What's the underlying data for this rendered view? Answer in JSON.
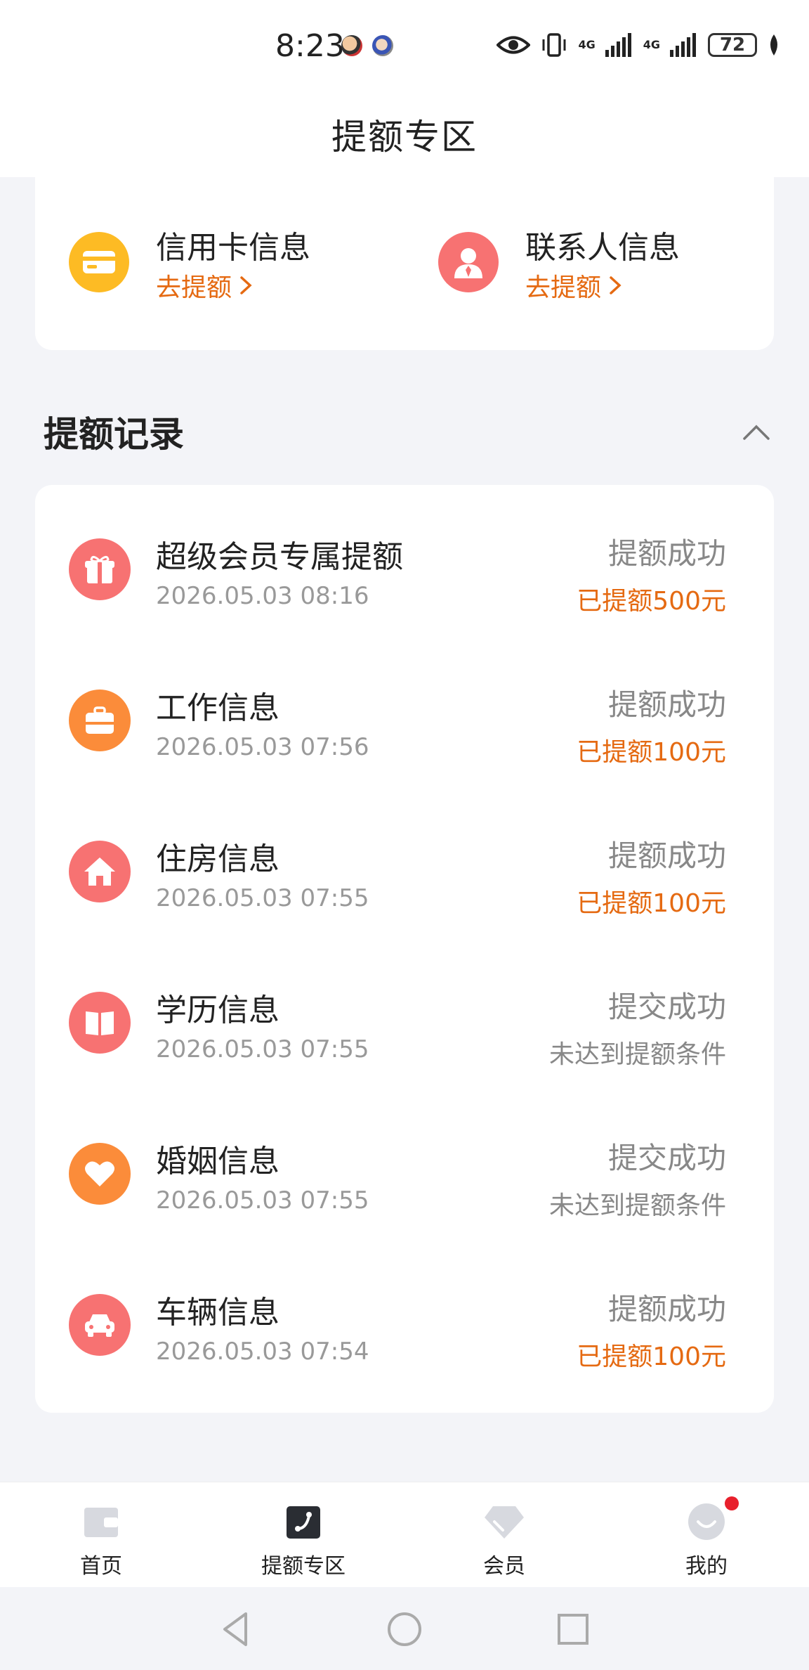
{
  "status_bar": {
    "time": "8:23",
    "network_1": "4G",
    "network_2": "4G",
    "battery": "72"
  },
  "header": {
    "title": "提额专区"
  },
  "info_cards": [
    {
      "title": "信用卡信息",
      "link": "去提额",
      "icon": "credit-card-icon",
      "color": "#fdbb24"
    },
    {
      "title": "联系人信息",
      "link": "去提额",
      "icon": "contact-person-icon",
      "color": "#f77272"
    }
  ],
  "records_section": {
    "title": "提额记录",
    "items": [
      {
        "title": "超级会员专属提额",
        "time": "2026.05.03 08:16",
        "status": "提额成功",
        "result": "已提额500元",
        "result_style": "orange",
        "icon": "gift-icon",
        "color": "#f77272"
      },
      {
        "title": "工作信息",
        "time": "2026.05.03 07:56",
        "status": "提额成功",
        "result": "已提额100元",
        "result_style": "orange",
        "icon": "briefcase-icon",
        "color": "#fb8c3a"
      },
      {
        "title": "住房信息",
        "time": "2026.05.03 07:55",
        "status": "提额成功",
        "result": "已提额100元",
        "result_style": "orange",
        "icon": "house-icon",
        "color": "#f77272"
      },
      {
        "title": "学历信息",
        "time": "2026.05.03 07:55",
        "status": "提交成功",
        "result": "未达到提额条件",
        "result_style": "gray",
        "icon": "book-icon",
        "color": "#f77272"
      },
      {
        "title": "婚姻信息",
        "time": "2026.05.03 07:55",
        "status": "提交成功",
        "result": "未达到提额条件",
        "result_style": "gray",
        "icon": "heart-icon",
        "color": "#fb8c3a"
      },
      {
        "title": "车辆信息",
        "time": "2026.05.03 07:54",
        "status": "提额成功",
        "result": "已提额100元",
        "result_style": "orange",
        "icon": "car-icon",
        "color": "#f77272"
      }
    ]
  },
  "bottom_nav": [
    {
      "label": "首页",
      "icon": "wallet-icon",
      "active": false
    },
    {
      "label": "提额专区",
      "icon": "phone-card-icon",
      "active": true
    },
    {
      "label": "会员",
      "icon": "diamond-icon",
      "active": false
    },
    {
      "label": "我的",
      "icon": "smiley-icon",
      "active": false,
      "badge": true
    }
  ],
  "colors": {
    "accent": "#e56a12",
    "badge": "#e8202c",
    "background": "#f3f4f8"
  }
}
